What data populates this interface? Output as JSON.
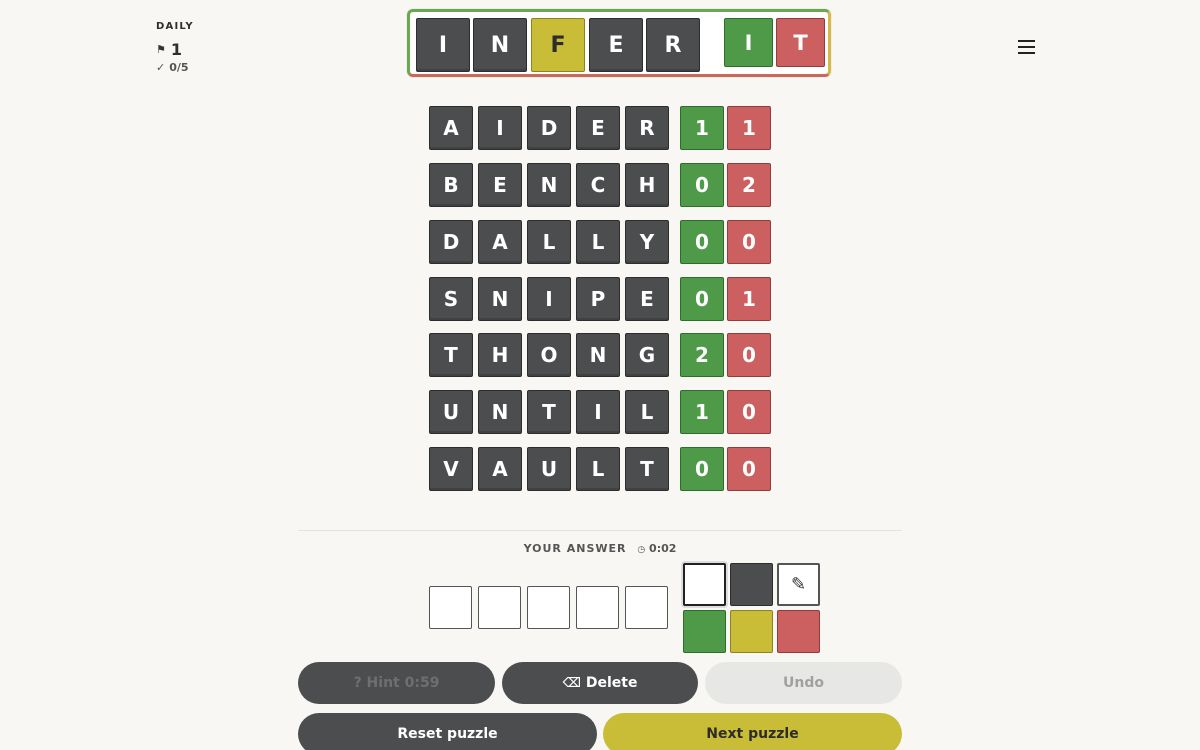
{
  "meta": {
    "mode": "DAILY",
    "flag_icon": "flag-icon",
    "puzzle_number": "1",
    "check_icon": "check-icon",
    "score": "0/5"
  },
  "target": {
    "letters": [
      "I",
      "N",
      "F",
      "E",
      "R"
    ],
    "letter_states": [
      "dark",
      "dark",
      "yellow",
      "dark",
      "dark"
    ],
    "clue_green": "I",
    "clue_red": "T"
  },
  "guesses": [
    {
      "letters": [
        "A",
        "I",
        "D",
        "E",
        "R"
      ],
      "green": "1",
      "red": "1"
    },
    {
      "letters": [
        "B",
        "E",
        "N",
        "C",
        "H"
      ],
      "green": "0",
      "red": "2"
    },
    {
      "letters": [
        "D",
        "A",
        "L",
        "L",
        "Y"
      ],
      "green": "0",
      "red": "0"
    },
    {
      "letters": [
        "S",
        "N",
        "I",
        "P",
        "E"
      ],
      "green": "0",
      "red": "1"
    },
    {
      "letters": [
        "T",
        "H",
        "O",
        "N",
        "G"
      ],
      "green": "2",
      "red": "0"
    },
    {
      "letters": [
        "U",
        "N",
        "T",
        "I",
        "L"
      ],
      "green": "1",
      "red": "0"
    },
    {
      "letters": [
        "V",
        "A",
        "U",
        "L",
        "T"
      ],
      "green": "0",
      "red": "0"
    }
  ],
  "answer": {
    "label": "YOUR ANSWER",
    "timer_icon": "clock-icon",
    "timer": "0:02",
    "boxes": [
      "",
      "",
      "",
      "",
      ""
    ]
  },
  "palette": {
    "eraser_icon": "eraser-icon",
    "colors": {
      "dark": "#4c4d4f",
      "green": "#4f9a49",
      "yellow": "#c9bd38",
      "red": "#cc5f5f"
    }
  },
  "buttons": {
    "hint_label": "? Hint 0:59",
    "delete_icon": "backspace-icon",
    "delete_label": "Delete",
    "undo_label": "Undo",
    "reset_label": "Reset puzzle",
    "next_label": "Next puzzle"
  },
  "menu_icon": "hamburger-menu-icon"
}
